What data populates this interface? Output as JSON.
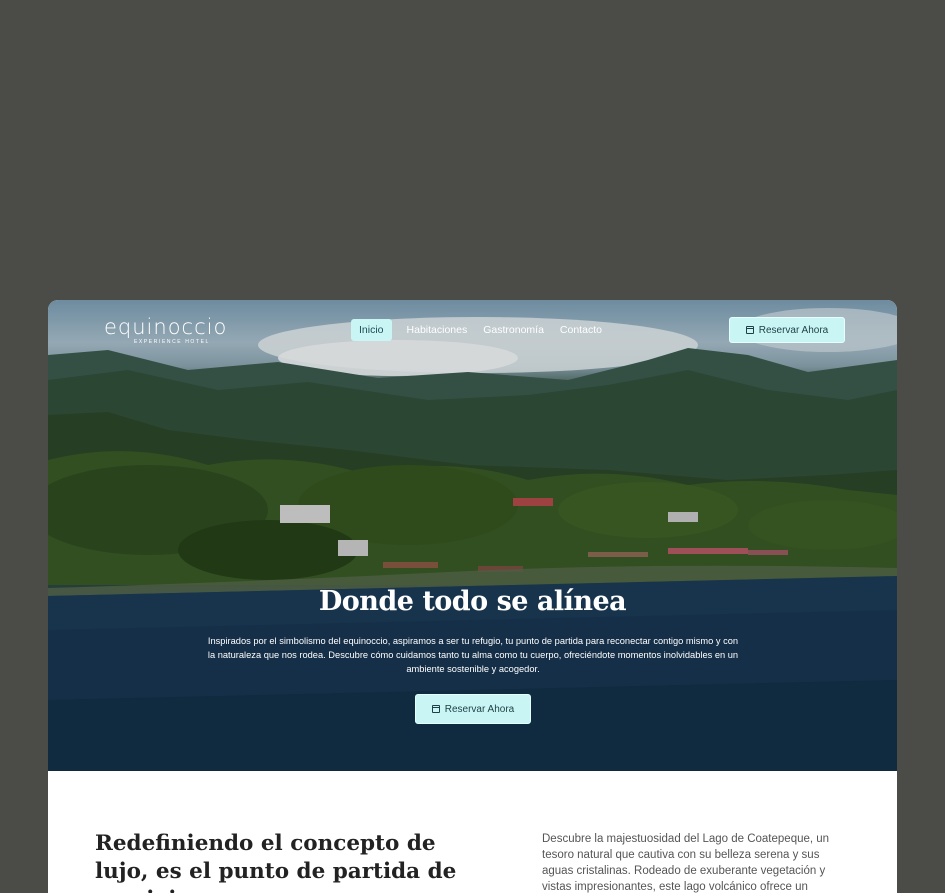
{
  "header": {
    "logo_text": "equinoccio",
    "logo_subtitle": "EXPERIENCE HOTEL",
    "nav": [
      {
        "label": "Inicio",
        "active": true
      },
      {
        "label": "Habitaciones",
        "active": false
      },
      {
        "label": "Gastronomía",
        "active": false
      },
      {
        "label": "Contacto",
        "active": false
      }
    ],
    "cta_label": "Reservar Ahora"
  },
  "hero": {
    "title": "Donde todo se alínea",
    "description": "Inspirados por el simbolismo del equinoccio, aspiramos a ser tu refugio, tu punto de partida para reconectar contigo mismo y con la naturaleza que nos rodea. Descubre cómo cuidamos tanto tu alma como tu cuerpo, ofreciéndote momentos inolvidables en un ambiente sostenible y acogedor.",
    "cta_label": "Reservar Ahora"
  },
  "intro": {
    "title": "Redefiniendo el concepto de lujo, es el punto de partida de un viaje",
    "text": "Descubre la majestuosidad del Lago de Coatepeque, un tesoro natural que cautiva con su belleza serena y sus aguas cristalinas. Rodeado de exuberante vegetación y vistas impresionantes, este lago volcánico ofrece un"
  },
  "colors": {
    "page_background": "#4b4b47",
    "accent_button": "#c9f5f5",
    "button_text": "#1d3f45"
  },
  "icons": {
    "cta_icon": "calendar-icon"
  }
}
